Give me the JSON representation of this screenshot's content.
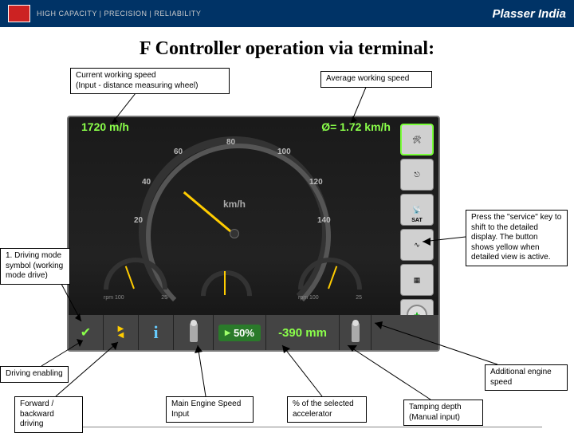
{
  "header": {
    "tagline": "HIGH CAPACITY | PRECISION | RELIABILITY",
    "brand": "Plasser India"
  },
  "title": "F Controller operation via terminal:",
  "callouts": {
    "cws": "Current working speed\n(Input - distance measuring wheel)",
    "aws": "Average working speed",
    "drive_mode": "1. Driving mode symbol (working mode drive)",
    "service": "Press the \"service\" key to shift to the detailed display. The button shows yellow when detailed view is active.",
    "driving_enabling": "Driving enabling",
    "fb_driving": "Forward / backward driving",
    "main_engine": "Main Engine Speed Input",
    "pct_accel": "% of the selected accelerator",
    "tamping_depth": "Tamping depth (Manual input)",
    "add_engine": "Additional engine speed"
  },
  "screen": {
    "speed_val": "1720 m/h",
    "avg_val": "Ø=  1.72 km/h",
    "kmh": "km/h",
    "ticks": {
      "t20": "20",
      "t40": "40",
      "t60": "60",
      "t80": "80",
      "t100": "100",
      "t120": "120",
      "t140": "140"
    },
    "sub_left": {
      "min": "rpm 100",
      "max": "25"
    },
    "sub_right": {
      "min": "rpm 100",
      "max": "25"
    },
    "side": {
      "sat": "SAT"
    },
    "bottom": {
      "pct": "50%",
      "mm": "-390 mm",
      "i": "i"
    }
  }
}
